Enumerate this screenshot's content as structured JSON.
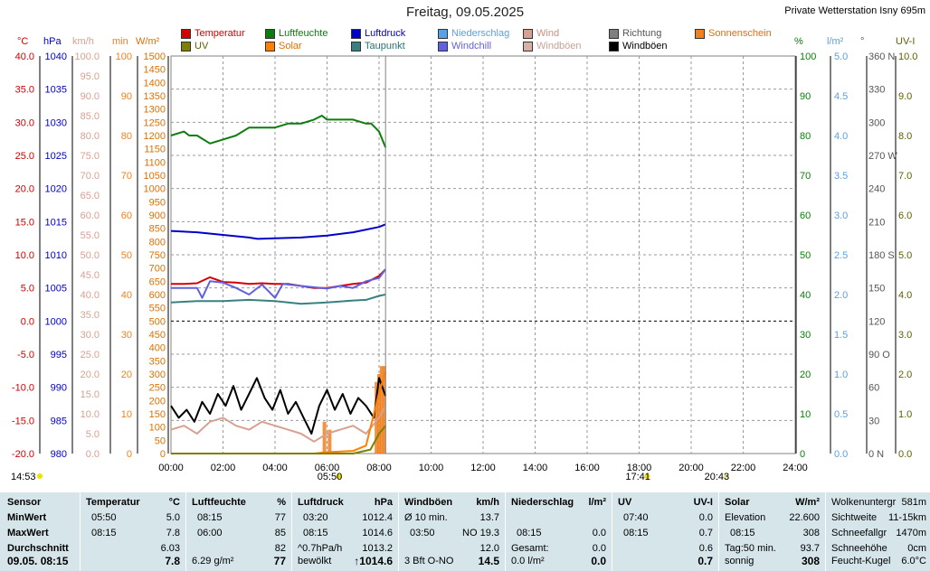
{
  "header": {
    "title": "Freitag, 09.05.2025",
    "station": "Private Wetterstation Isny 695m"
  },
  "legend": [
    {
      "label": "Temperatur",
      "color": "#d40000",
      "text_color": "#d40000"
    },
    {
      "label": "Luftfeuchte",
      "color": "#0a7d0a",
      "text_color": "#0a7d0a"
    },
    {
      "label": "Luftdruck",
      "color": "#0000c8",
      "text_color": "#0000c8"
    },
    {
      "label": "Niederschlag",
      "color": "#5aa0e6",
      "text_color": "#5aa0e6"
    },
    {
      "label": "Wind",
      "color": "#d8a090",
      "text_color": "#c89080"
    },
    {
      "label": "Richtung",
      "color": "#808080",
      "text_color": "#555555"
    },
    {
      "label": "Sonnenschein",
      "color": "#f08020",
      "text_color": "#e07010"
    },
    {
      "label": "UV",
      "color": "#808000",
      "text_color": "#606000"
    },
    {
      "label": "Solar",
      "color": "#ff8000",
      "text_color": "#e07000"
    },
    {
      "label": "Taupunkt",
      "color": "#3a8080",
      "text_color": "#2a7070"
    },
    {
      "label": "Windchill",
      "color": "#6060e0",
      "text_color": "#6060e0"
    },
    {
      "label": "Windböen",
      "color": "#d8b0a8",
      "text_color": "#c8a098"
    },
    {
      "label": "Windböen",
      "color": "#000000",
      "text_color": "#000000"
    }
  ],
  "axis_units": {
    "temp": "°C",
    "pressure": "hPa",
    "wind": "km/h",
    "minutes": "min",
    "solar": "W/m²",
    "humidity": "%",
    "rain": "l/m²",
    "direction": "°",
    "uv": "UV-I"
  },
  "chart_data": {
    "type": "line",
    "x_range": [
      "00:00",
      "24:00"
    ],
    "x_ticks": [
      "00:00",
      "02:00",
      "04:00",
      "06:00",
      "08:00",
      "10:00",
      "12:00",
      "14:00",
      "16:00",
      "18:00",
      "20:00",
      "22:00",
      "24:00"
    ],
    "axes": {
      "temp": {
        "ticks": [
          "40.0",
          "35.0",
          "30.0",
          "25.0",
          "20.0",
          "15.0",
          "10.0",
          "5.0",
          "0.0",
          "-5.0",
          "-10.0",
          "-15.0",
          "-20.0"
        ],
        "range": [
          -20,
          40
        ]
      },
      "pressure": {
        "ticks": [
          "1040",
          "1035",
          "1030",
          "1025",
          "1020",
          "1015",
          "1010",
          "1005",
          "1000",
          "995",
          "990",
          "985",
          "980"
        ],
        "range": [
          980,
          1040
        ]
      },
      "wind": {
        "ticks": [
          "100.0",
          "95.0",
          "90.0",
          "85.0",
          "80.0",
          "75.0",
          "70.0",
          "65.0",
          "60.0",
          "55.0",
          "50.0",
          "45.0",
          "40.0",
          "35.0",
          "30.0",
          "25.0",
          "20.0",
          "15.0",
          "10.0",
          "5.0",
          "0.0"
        ],
        "range": [
          0,
          100
        ]
      },
      "minutes": {
        "ticks": [
          "100",
          "90",
          "80",
          "70",
          "60",
          "50",
          "40",
          "30",
          "20",
          "10",
          "0"
        ],
        "range": [
          0,
          100
        ]
      },
      "solar": {
        "ticks": [
          "1500",
          "1450",
          "1400",
          "1350",
          "1300",
          "1250",
          "1200",
          "1150",
          "1100",
          "1050",
          "1000",
          "950",
          "900",
          "850",
          "800",
          "750",
          "700",
          "650",
          "600",
          "550",
          "500",
          "450",
          "400",
          "350",
          "300",
          "250",
          "200",
          "150",
          "100",
          "50",
          "0"
        ],
        "range": [
          0,
          1500
        ]
      },
      "humidity": {
        "ticks": [
          "100",
          "90",
          "80",
          "70",
          "60",
          "50",
          "40",
          "30",
          "20",
          "10",
          "0"
        ],
        "range": [
          0,
          100
        ]
      },
      "rain": {
        "ticks": [
          "5.0",
          "4.5",
          "4.0",
          "3.5",
          "3.0",
          "2.5",
          "2.0",
          "1.5",
          "1.0",
          "0.5",
          "0.0"
        ],
        "range": [
          0,
          5
        ]
      },
      "direction": {
        "ticks": [
          "360 N",
          "330",
          "300",
          "270 W",
          "240",
          "210",
          "180 S",
          "150",
          "120",
          "90 O",
          "60",
          "30",
          "0 N"
        ],
        "range": [
          0,
          360
        ]
      },
      "uv": {
        "ticks": [
          "10.0",
          "9.0",
          "8.0",
          "7.0",
          "6.0",
          "5.0",
          "4.0",
          "3.0",
          "2.0",
          "1.0",
          "0.0"
        ],
        "range": [
          0,
          10
        ]
      }
    },
    "series": [
      {
        "name": "Temperatur",
        "axis": "temp",
        "color": "#d40000",
        "points": [
          [
            0,
            5.6
          ],
          [
            0.5,
            5.6
          ],
          [
            1,
            5.7
          ],
          [
            1.5,
            6.6
          ],
          [
            2,
            5.9
          ],
          [
            2.5,
            5.8
          ],
          [
            3,
            5.6
          ],
          [
            3.5,
            5.7
          ],
          [
            4,
            5.6
          ],
          [
            4.5,
            5.6
          ],
          [
            5,
            5.3
          ],
          [
            5.5,
            5.0
          ],
          [
            6,
            5.0
          ],
          [
            6.5,
            5.3
          ],
          [
            7,
            5.6
          ],
          [
            7.5,
            5.8
          ],
          [
            8,
            6.8
          ],
          [
            8.25,
            7.8
          ]
        ]
      },
      {
        "name": "Luftfeuchte",
        "axis": "humidity",
        "color": "#0a7d0a",
        "points": [
          [
            0,
            80
          ],
          [
            0.5,
            81
          ],
          [
            0.7,
            80
          ],
          [
            1,
            80
          ],
          [
            1.5,
            78
          ],
          [
            2,
            79
          ],
          [
            2.5,
            80
          ],
          [
            3,
            82
          ],
          [
            3.5,
            82
          ],
          [
            4,
            82
          ],
          [
            4.5,
            83
          ],
          [
            5,
            83
          ],
          [
            5.5,
            84
          ],
          [
            5.8,
            85
          ],
          [
            6,
            84
          ],
          [
            6.5,
            84
          ],
          [
            7,
            84
          ],
          [
            7.5,
            83
          ],
          [
            7.7,
            83
          ],
          [
            8,
            81
          ],
          [
            8.25,
            77
          ]
        ]
      },
      {
        "name": "Luftdruck",
        "axis": "pressure",
        "color": "#0000c8",
        "points": [
          [
            0,
            1013.6
          ],
          [
            1,
            1013.4
          ],
          [
            2,
            1013.0
          ],
          [
            3,
            1012.6
          ],
          [
            3.33,
            1012.4
          ],
          [
            4,
            1012.5
          ],
          [
            5,
            1012.6
          ],
          [
            6,
            1012.9
          ],
          [
            7,
            1013.4
          ],
          [
            8,
            1014.2
          ],
          [
            8.25,
            1014.6
          ]
        ]
      },
      {
        "name": "Taupunkt",
        "axis": "temp",
        "color": "#3a8080",
        "points": [
          [
            0,
            2.8
          ],
          [
            1,
            3.0
          ],
          [
            2,
            3.0
          ],
          [
            3,
            3.2
          ],
          [
            4,
            3.0
          ],
          [
            5,
            2.6
          ],
          [
            6,
            2.8
          ],
          [
            7,
            3.1
          ],
          [
            7.5,
            3.2
          ],
          [
            8,
            3.8
          ],
          [
            8.25,
            4.0
          ]
        ]
      },
      {
        "name": "Windchill",
        "axis": "temp",
        "color": "#6060e0",
        "points": [
          [
            0,
            5.0
          ],
          [
            1,
            5.0
          ],
          [
            1.2,
            3.5
          ],
          [
            1.5,
            6.0
          ],
          [
            2,
            5.8
          ],
          [
            2.5,
            5.0
          ],
          [
            3,
            4.0
          ],
          [
            3.5,
            5.5
          ],
          [
            4,
            3.5
          ],
          [
            4.3,
            5.6
          ],
          [
            5,
            5.3
          ],
          [
            6,
            4.9
          ],
          [
            6.5,
            5.3
          ],
          [
            7,
            5.0
          ],
          [
            7.5,
            6.0
          ],
          [
            8,
            6.5
          ],
          [
            8.25,
            7.8
          ]
        ]
      },
      {
        "name": "Windböen",
        "axis": "wind",
        "color": "#000000",
        "points": [
          [
            0,
            12
          ],
          [
            0.3,
            9
          ],
          [
            0.6,
            11
          ],
          [
            0.9,
            8
          ],
          [
            1.2,
            13
          ],
          [
            1.5,
            10
          ],
          [
            1.8,
            15
          ],
          [
            2.1,
            12
          ],
          [
            2.4,
            17
          ],
          [
            2.7,
            11
          ],
          [
            3,
            15
          ],
          [
            3.3,
            19
          ],
          [
            3.6,
            14
          ],
          [
            3.9,
            11
          ],
          [
            4.2,
            16
          ],
          [
            4.5,
            10
          ],
          [
            4.8,
            13
          ],
          [
            5.1,
            9
          ],
          [
            5.4,
            5
          ],
          [
            5.7,
            12
          ],
          [
            6,
            16
          ],
          [
            6.3,
            11
          ],
          [
            6.6,
            15
          ],
          [
            6.9,
            10
          ],
          [
            7.2,
            14
          ],
          [
            7.5,
            12
          ],
          [
            7.8,
            9
          ],
          [
            8,
            19
          ],
          [
            8.25,
            14.5
          ]
        ]
      },
      {
        "name": "Wind",
        "axis": "wind",
        "color": "#d8a090",
        "points": [
          [
            0,
            6
          ],
          [
            0.5,
            7
          ],
          [
            1,
            5
          ],
          [
            1.5,
            8
          ],
          [
            2,
            9
          ],
          [
            2.5,
            7
          ],
          [
            3,
            6
          ],
          [
            3.5,
            8
          ],
          [
            4,
            7
          ],
          [
            4.5,
            6
          ],
          [
            5,
            5
          ],
          [
            5.5,
            3
          ],
          [
            6,
            5
          ],
          [
            6.5,
            6
          ],
          [
            7,
            7
          ],
          [
            7.5,
            5
          ],
          [
            8,
            9
          ],
          [
            8.25,
            12
          ]
        ]
      },
      {
        "name": "Solar",
        "axis": "solar",
        "color": "#ff8000",
        "points": [
          [
            0,
            0
          ],
          [
            5.5,
            0
          ],
          [
            6,
            5
          ],
          [
            7,
            10
          ],
          [
            7.5,
            30
          ],
          [
            7.8,
            150
          ],
          [
            8,
            230
          ],
          [
            8.25,
            308
          ]
        ]
      },
      {
        "name": "UV",
        "axis": "uv",
        "color": "#808000",
        "points": [
          [
            0,
            0
          ],
          [
            7,
            0
          ],
          [
            7.67,
            0.1
          ],
          [
            8,
            0.5
          ],
          [
            8.25,
            0.7
          ]
        ]
      }
    ],
    "sunshine_bars": [
      [
        5.9,
        8
      ],
      [
        6.1,
        6
      ],
      [
        7.9,
        18
      ],
      [
        8.0,
        20
      ],
      [
        8.1,
        22
      ],
      [
        8.2,
        22
      ]
    ],
    "current_time_marker": "08:15",
    "sun_events": {
      "sunrise": "05:50",
      "sunset": "20:43",
      "moonrise": "14:53",
      "noon_marker": "17:41"
    }
  },
  "table": {
    "sensor": {
      "header": "Sensor",
      "rows": [
        "MinWert",
        "MaxWert",
        "Durchschnitt",
        "09.05. 08:15"
      ]
    },
    "temperatur": {
      "header": "Temperatur",
      "unit": "°C",
      "min_time": "05:50",
      "min": "5.0",
      "max_time": "08:15",
      "max": "7.8",
      "avg": "6.03",
      "now": "7.8"
    },
    "luftfeuchte": {
      "header": "Luftfeuchte",
      "unit": "%",
      "min_time": "08:15",
      "min": "77",
      "max_time": "06:00",
      "max": "85",
      "avg": "82",
      "abs": "6.29 g/m²",
      "now": "77"
    },
    "luftdruck": {
      "header": "Luftdruck",
      "unit": "hPa",
      "min_time": "03:20",
      "min": "1012.4",
      "max_time": "08:15",
      "max": "1014.6",
      "trend": "^0.7hPa/h",
      "avg": "1013.2",
      "state": "bewölkt",
      "now": "↑1014.6"
    },
    "windboeen": {
      "header": "Windböen",
      "unit": "km/h",
      "r1_label": "Ø 10 min.",
      "r1": "13.7",
      "r2_time": "03:50",
      "r2_dir": "NO 19.3",
      "avg": "12.0",
      "bft": "3 Bft O-NO",
      "now": "14.5"
    },
    "niederschlag": {
      "header": "Niederschlag",
      "unit": "l/m²",
      "max_time": "08:15",
      "max": "0.0",
      "total_label": "Gesamt:",
      "total": "0.0",
      "rate": "0.0 l/m²",
      "now": "0.0"
    },
    "uv": {
      "header": "UV",
      "unit": "UV-I",
      "min_time": "07:40",
      "min": "0.0",
      "max_time": "08:15",
      "max": "0.7",
      "avg": "0.6",
      "now": "0.7"
    },
    "solar": {
      "header": "Solar",
      "unit": "W/m²",
      "elev_label": "Elevation",
      "elev": "22.600",
      "max_time": "08:15",
      "max": "308",
      "tag_label": "Tag:50 min.",
      "tag": "93.7",
      "state": "sonnig",
      "now": "308"
    },
    "extra": [
      {
        "label": "Wolkenuntergr",
        "value": "581m"
      },
      {
        "label": "Sichtweite",
        "value": "11-15km"
      },
      {
        "label": "Schneefallgr",
        "value": "1470m"
      },
      {
        "label": "Schneehöhe",
        "value": "0cm"
      },
      {
        "label": "Feucht-Kugel",
        "value": "6.0°C"
      }
    ]
  }
}
